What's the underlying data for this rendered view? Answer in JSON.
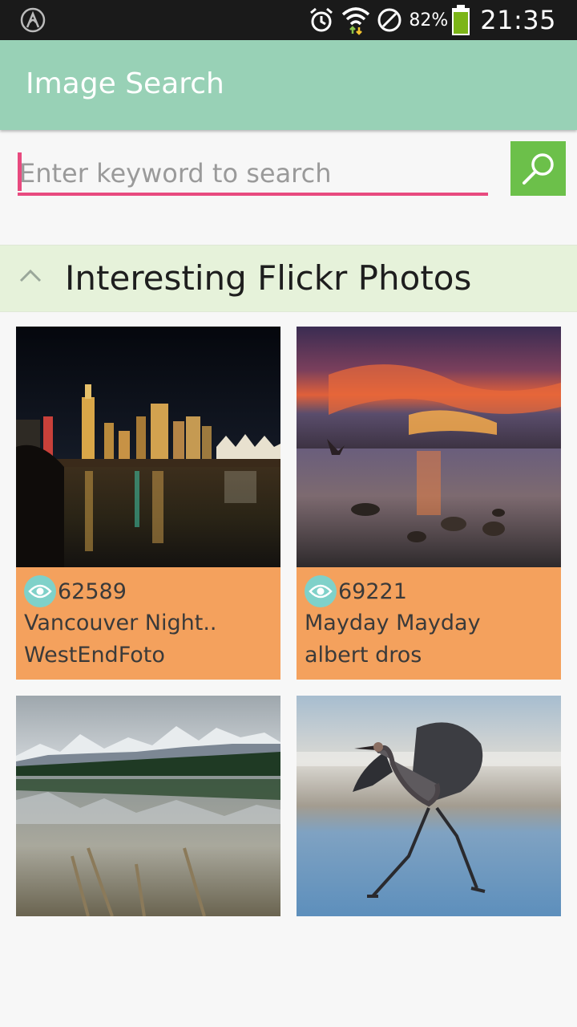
{
  "status_bar": {
    "battery_percent": "82%",
    "time": "21:35",
    "icons": [
      "app-notification-icon",
      "alarm-icon",
      "wifi-icon",
      "blocked-icon",
      "battery-icon"
    ]
  },
  "app_bar": {
    "title": "Image Search"
  },
  "search": {
    "placeholder": "Enter keyword to search",
    "value": ""
  },
  "section": {
    "title": "Interesting Flickr Photos"
  },
  "photos": [
    {
      "views": "62589",
      "title": "Vancouver Night..",
      "author": "WestEndFoto",
      "subject": "night city skyline reflected on water"
    },
    {
      "views": "69221",
      "title": "Mayday Mayday",
      "author": "albert dros",
      "subject": "sunset over sea with rocks"
    },
    {
      "subject": "snowy mountains reflected in lake"
    },
    {
      "subject": "heron walking in water"
    }
  ],
  "colors": {
    "status_bar": "#1a1a1a",
    "app_bar": "#98d1b6",
    "accent": "#e84a7f",
    "search_button": "#6cc04a",
    "section_bg": "#e6f2da",
    "card_info": "#f4a15d",
    "eye_badge": "#7fd1c9"
  }
}
